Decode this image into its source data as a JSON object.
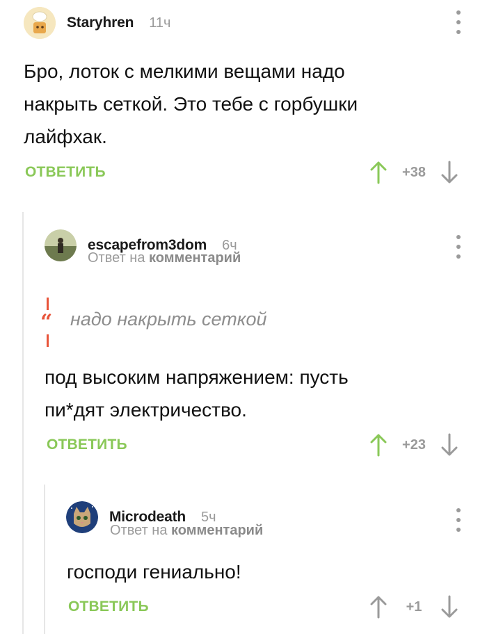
{
  "comments": [
    {
      "username": "Staryhren",
      "time": "11ч",
      "text_lines": [
        "Бро, лоток с мелкими вещами надо",
        "накрыть сеткой. Это тебе с горбушки",
        "лайфхак."
      ],
      "reply_label": "ОТВЕТИТЬ",
      "score": "+38",
      "upvote_color": "#8ac858"
    },
    {
      "username": "escapefrom3dom",
      "time": "6ч",
      "reply_to_prefix": "Ответ на",
      "reply_to_link": "комментарий",
      "quote": "надо накрыть сеткой",
      "text_lines": [
        "под высоким напряжением: пусть",
        "пи*дят электричество."
      ],
      "reply_label": "ОТВЕТИТЬ",
      "score": "+23",
      "upvote_color": "#8ac858"
    },
    {
      "username": "Microdeath",
      "time": "5ч",
      "reply_to_prefix": "Ответ на",
      "reply_to_link": "комментарий",
      "text_lines": [
        "господи гениально!"
      ],
      "reply_label": "ОТВЕТИТЬ",
      "score": "+1",
      "upvote_color": "#9a9a9a"
    }
  ],
  "colors": {
    "accent_green": "#8ac858",
    "quote_red": "#e8543a",
    "muted_gray": "#9a9a9a"
  }
}
